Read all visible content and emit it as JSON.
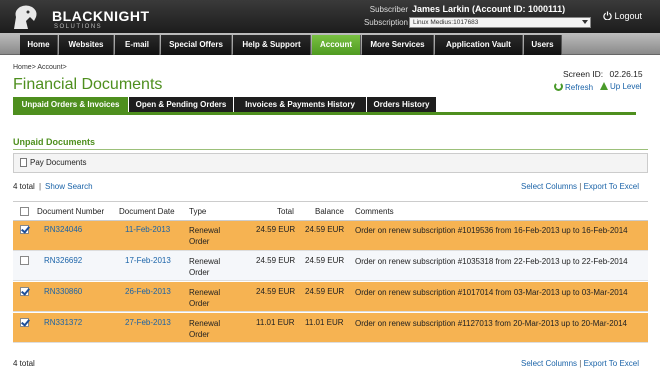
{
  "brand": {
    "name": "BLACKNIGHT",
    "tagline": "SOLUTIONS"
  },
  "header": {
    "subscriber_label": "Subscriber",
    "subscriber_value": "James Larkin (Account ID: 1000111)",
    "subscription_label": "Subscription",
    "subscription_value": "Linux Medius:1017683",
    "logout_label": "Logout"
  },
  "nav": {
    "items": [
      "Home",
      "Websites",
      "E-mail",
      "Special Offers",
      "Help & Support",
      "Account",
      "More Services",
      "Application Vault",
      "Users"
    ],
    "active": "Account"
  },
  "breadcrumb": [
    "Home",
    "Account"
  ],
  "page": {
    "title": "Financial Documents",
    "screen_id_label": "Screen ID:",
    "screen_id": "02.26.15",
    "refresh_label": "Refresh",
    "up_level_label": "Up Level"
  },
  "subtabs": {
    "items": [
      "Unpaid Orders & Invoices",
      "Open & Pending Orders",
      "Invoices & Payments History",
      "Orders History"
    ],
    "active": "Unpaid Orders & Invoices"
  },
  "section": {
    "title": "Unpaid Documents",
    "pay_button": "Pay Documents",
    "total_top": "4 total",
    "show_search": "Show Search",
    "select_columns": "Select Columns",
    "export": "Export To Excel",
    "total_bottom": "4 total"
  },
  "table": {
    "columns": [
      "Document Number",
      "Document Date",
      "Type",
      "Total",
      "Balance",
      "Comments"
    ],
    "rows": [
      {
        "checked": true,
        "number": "RN324046",
        "date": "11-Feb-2013",
        "type": "Renewal Order",
        "total": "24.59 EUR",
        "balance": "24.59 EUR",
        "comment": "Order on renew subscription #1019536 from 16-Feb-2013 up to 16-Feb-2014"
      },
      {
        "checked": false,
        "number": "RN326692",
        "date": "17-Feb-2013",
        "type": "Renewal Order",
        "total": "24.59 EUR",
        "balance": "24.59 EUR",
        "comment": "Order on renew subscription #1035318 from 22-Feb-2013 up to 22-Feb-2014"
      },
      {
        "checked": true,
        "number": "RN330860",
        "date": "26-Feb-2013",
        "type": "Renewal Order",
        "total": "24.59 EUR",
        "balance": "24.59 EUR",
        "comment": "Order on renew subscription #1017014 from 03-Mar-2013 up to 03-Mar-2014"
      },
      {
        "checked": true,
        "number": "RN331372",
        "date": "27-Feb-2013",
        "type": "Renewal Order",
        "total": "11.01 EUR",
        "balance": "11.01 EUR",
        "comment": "Order on renew subscription #1127013 from 20-Mar-2013 up to 20-Mar-2014"
      }
    ]
  },
  "colors": {
    "accent": "#4e8f1e",
    "selected_row": "#f6b352",
    "link": "#1a63a8"
  }
}
